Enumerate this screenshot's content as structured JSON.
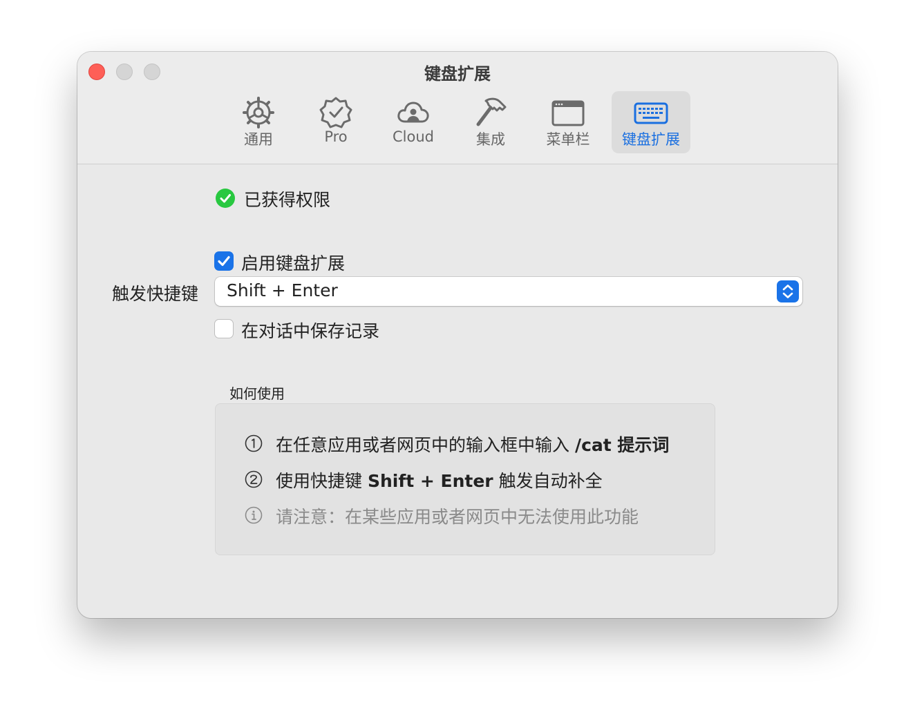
{
  "window": {
    "title": "键盘扩展"
  },
  "tabs": [
    {
      "label": "通用",
      "icon": "gear-icon"
    },
    {
      "label": "Pro",
      "icon": "verified-badge-icon"
    },
    {
      "label": "Cloud",
      "icon": "cloud-person-icon"
    },
    {
      "label": "集成",
      "icon": "hammer-icon"
    },
    {
      "label": "菜单栏",
      "icon": "menubar-window-icon"
    },
    {
      "label": "键盘扩展",
      "icon": "keyboard-icon",
      "active": true
    }
  ],
  "permission": {
    "text": "已获得权限",
    "status": "granted"
  },
  "enable_extension": {
    "label": "启用键盘扩展",
    "checked": true
  },
  "shortcut": {
    "label": "触发快捷键",
    "value": "Shift + Enter"
  },
  "save_history": {
    "label": "在对话中保存记录",
    "checked": false
  },
  "howto": {
    "title": "如何使用",
    "step1": {
      "prefix": "在任意应用或者网页中的输入框中输入 ",
      "bold": "/cat 提示词"
    },
    "step2": {
      "prefix": "使用快捷键 ",
      "bold": "Shift + Enter",
      "suffix": " 触发自动补全"
    },
    "note": "请注意：在某些应用或者网页中无法使用此功能"
  },
  "colors": {
    "accent": "#1a73e8",
    "active_tab_text": "#1a6fe0",
    "success": "#28c840",
    "close": "#fe5f57"
  }
}
